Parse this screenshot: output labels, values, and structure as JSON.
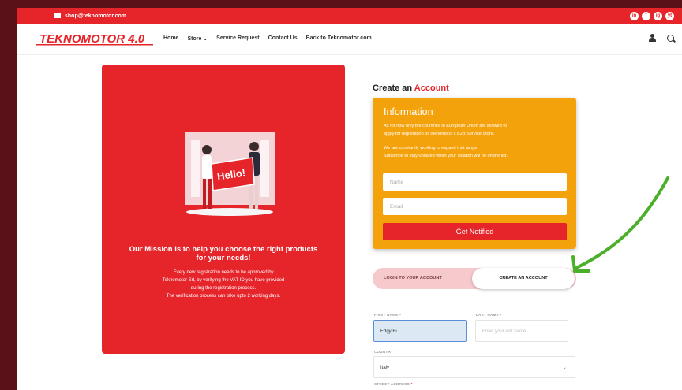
{
  "topbar": {
    "email": "shop@teknomotor.com",
    "socials": [
      "in",
      "f",
      "ig",
      "yt"
    ]
  },
  "nav": {
    "logo_text": "TEKNOMOTOR 4.0",
    "links": [
      "Home",
      "Store ⌄",
      "Service Request",
      "Contact Us",
      "Back to Teknomotor.com"
    ]
  },
  "mission": {
    "illustration_text": "Hello!",
    "title_line1": "Our Mission is to help you choose the right products",
    "title_line2": "for your needs!",
    "lines": [
      "Every new registration needs to be approved by",
      "Teknomotor Srl, by verifying the VAT ID you have provided",
      "during the registration process.",
      "The verification process can take upto 2 working days."
    ]
  },
  "create": {
    "title_prefix": "Create an ",
    "title_accent": "Account"
  },
  "info": {
    "heading": "Information",
    "lines": [
      "As for now only the countries in European Union are allowed to",
      "apply for registration to Teknomotor's B2B Service Store.",
      "We are constantly working to expand that range.",
      "Subscribe to stay updated when your location will be on the list."
    ],
    "name_placeholder": "Name",
    "email_placeholder": "Email",
    "button": "Get Notified"
  },
  "toggle": {
    "login": "LOGIN TO YOUR ACCOUNT",
    "create": "CREATE AN ACCOUNT"
  },
  "form": {
    "first_name_label": "FIRST NAME",
    "first_name_value": "Edgy Bi",
    "last_name_label": "LAST NAME",
    "last_name_placeholder": "Enter your last name",
    "country_label": "COUNTRY",
    "country_value": "Italy",
    "street_label": "STREET ADDRESS",
    "required_mark": "*"
  },
  "colors": {
    "brand_red": "#e6252b",
    "info_orange": "#f4a20c",
    "arrow_green": "#4caf2a"
  }
}
